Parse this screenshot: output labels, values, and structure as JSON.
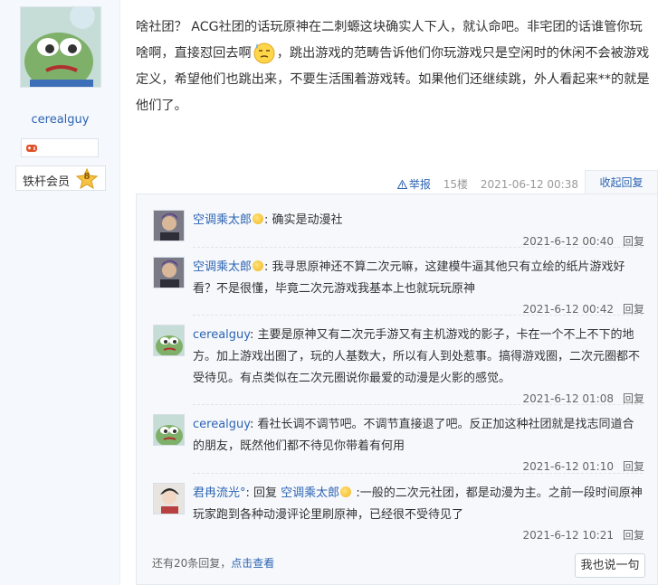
{
  "author": {
    "username": "cerealguy",
    "member_label": "铁杆会员",
    "member_level": "8"
  },
  "post": {
    "text_part1": "啥社团？ ACG社团的话玩原神在二刺螈这块确实人下人，就认命吧。非宅团的话谁管你玩啥啊，直接怼回去啊",
    "text_part2": "，跳出游戏的范畴告诉他们你玩游戏只是空闲时的休闲不会被游戏定义，希望他们也跳出来，不要生活围着游戏转。如果他们还继续跳，外人看起来**的就是他们了。",
    "report_label": "举报",
    "floor": "15楼",
    "timestamp": "2021-06-12 00:38",
    "collapse_label": "收起回复"
  },
  "replies": [
    {
      "name": "空调乘太郎",
      "text": ": 确实是动漫社",
      "time": "2021-6-12 00:40",
      "reply_label": "回复"
    },
    {
      "name": "空调乘太郎",
      "text": ": 我寻思原神还不算二次元嘛，这建模牛逼其他只有立绘的纸片游戏好看？不是很懂，毕竟二次元游戏我基本上也就玩玩原神",
      "time": "2021-6-12 00:42",
      "reply_label": "回复"
    },
    {
      "name": "cerealguy",
      "text": ": 主要是原神又有二次元手游又有主机游戏的影子，卡在一个不上不下的地方。加上游戏出圈了，玩的人基数大，所以有人到处惹事。搞得游戏圈，二次元圈都不受待见。有点类似在二次元圈说你最爱的动漫是火影的感觉。",
      "time": "2021-6-12 01:08",
      "reply_label": "回复"
    },
    {
      "name": "cerealguy",
      "text": ": 看社长调不调节吧。不调节直接退了吧。反正加这种社团就是找志同道合的朋友，既然他们都不待见你带着有何用",
      "time": "2021-6-12 01:10",
      "reply_label": "回复"
    },
    {
      "name": "君冉流光°",
      "reply_prefix": ": 回复 ",
      "reply_to": "空调乘太郎",
      "text": " :一般的二次元社团，都是动漫为主。之前一段时间原神玩家跑到各种动漫评论里刷原神，已经很不受待见了",
      "time": "2021-6-12 10:21",
      "reply_label": "回复"
    }
  ],
  "footer": {
    "more_text": "还有20条回复，",
    "more_link": "点击查看",
    "say_button": "我也说一句"
  }
}
